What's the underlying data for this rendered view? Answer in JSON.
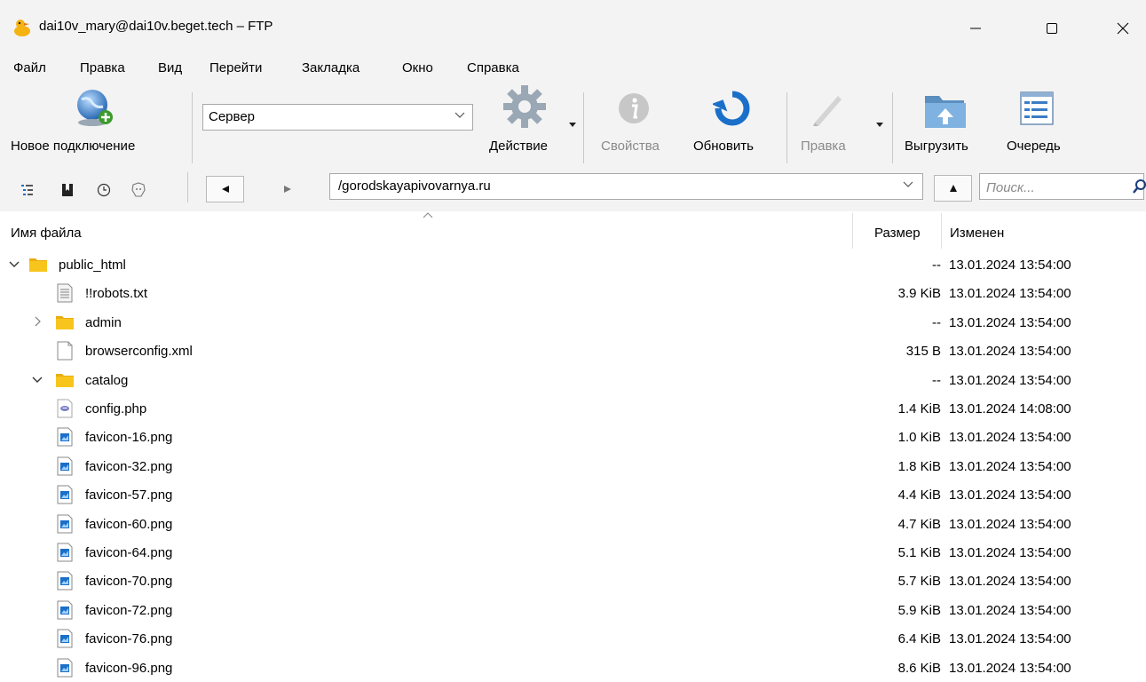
{
  "window": {
    "title": "dai10v_mary@dai10v.beget.tech – FTP"
  },
  "menu": [
    "Файл",
    "Правка",
    "Вид",
    "Перейти",
    "Закладка",
    "Окно",
    "Справка"
  ],
  "toolbar": {
    "new_connection": "Новое подключение",
    "server_value": "Сервер",
    "action": "Действие",
    "properties": "Свойства",
    "refresh": "Обновить",
    "edit": "Правка",
    "upload": "Выгрузить",
    "queue": "Очередь"
  },
  "nav": {
    "path": "/gorodskayapivovarnya.ru",
    "search_placeholder": "Поиск..."
  },
  "columns": {
    "name": "Имя файла",
    "size": "Размер",
    "modified": "Изменен"
  },
  "files": [
    {
      "name": "public_html",
      "type": "folder",
      "level": 0,
      "expander": "expanded",
      "size": "--",
      "modified": "13.01.2024 13:54:00"
    },
    {
      "name": "!!robots.txt",
      "type": "text",
      "level": 1,
      "expander": "none",
      "size": "3.9 KiB",
      "modified": "13.01.2024 13:54:00"
    },
    {
      "name": "admin",
      "type": "folder",
      "level": 1,
      "expander": "collapsed",
      "size": "--",
      "modified": "13.01.2024 13:54:00"
    },
    {
      "name": "browserconfig.xml",
      "type": "xml",
      "level": 1,
      "expander": "none",
      "size": "315 B",
      "modified": "13.01.2024 13:54:00"
    },
    {
      "name": "catalog",
      "type": "folder",
      "level": 1,
      "expander": "expanded",
      "size": "--",
      "modified": "13.01.2024 13:54:00"
    },
    {
      "name": "config.php",
      "type": "php",
      "level": 1,
      "expander": "none",
      "size": "1.4 KiB",
      "modified": "13.01.2024 14:08:00"
    },
    {
      "name": "favicon-16.png",
      "type": "image",
      "level": 1,
      "expander": "none",
      "size": "1.0 KiB",
      "modified": "13.01.2024 13:54:00"
    },
    {
      "name": "favicon-32.png",
      "type": "image",
      "level": 1,
      "expander": "none",
      "size": "1.8 KiB",
      "modified": "13.01.2024 13:54:00"
    },
    {
      "name": "favicon-57.png",
      "type": "image",
      "level": 1,
      "expander": "none",
      "size": "4.4 KiB",
      "modified": "13.01.2024 13:54:00"
    },
    {
      "name": "favicon-60.png",
      "type": "image",
      "level": 1,
      "expander": "none",
      "size": "4.7 KiB",
      "modified": "13.01.2024 13:54:00"
    },
    {
      "name": "favicon-64.png",
      "type": "image",
      "level": 1,
      "expander": "none",
      "size": "5.1 KiB",
      "modified": "13.01.2024 13:54:00"
    },
    {
      "name": "favicon-70.png",
      "type": "image",
      "level": 1,
      "expander": "none",
      "size": "5.7 KiB",
      "modified": "13.01.2024 13:54:00"
    },
    {
      "name": "favicon-72.png",
      "type": "image",
      "level": 1,
      "expander": "none",
      "size": "5.9 KiB",
      "modified": "13.01.2024 13:54:00"
    },
    {
      "name": "favicon-76.png",
      "type": "image",
      "level": 1,
      "expander": "none",
      "size": "6.4 KiB",
      "modified": "13.01.2024 13:54:00"
    },
    {
      "name": "favicon-96.png",
      "type": "image",
      "level": 1,
      "expander": "none",
      "size": "8.6 KiB",
      "modified": "13.01.2024 13:54:00"
    }
  ],
  "icons": {
    "app": "duck-icon",
    "minimize": "minimize-icon",
    "maximize": "maximize-icon",
    "close": "close-icon",
    "new_connection": "globe-plus-icon",
    "action": "gear-icon",
    "properties": "info-icon",
    "refresh": "refresh-icon",
    "edit": "pencil-icon",
    "upload": "upload-folder-icon",
    "queue": "queue-list-icon",
    "outline": "outline-icon",
    "bookmarks": "bookmark-icon",
    "history": "clock-icon",
    "bonjour": "bonjour-icon",
    "back": "back-arrow-icon",
    "forward": "forward-arrow-icon",
    "up": "up-arrow-icon",
    "search": "search-icon"
  },
  "colors": {
    "chrome": "#f3f3f3",
    "folder": "#f8c51c",
    "accent": "#1a6fc9"
  }
}
